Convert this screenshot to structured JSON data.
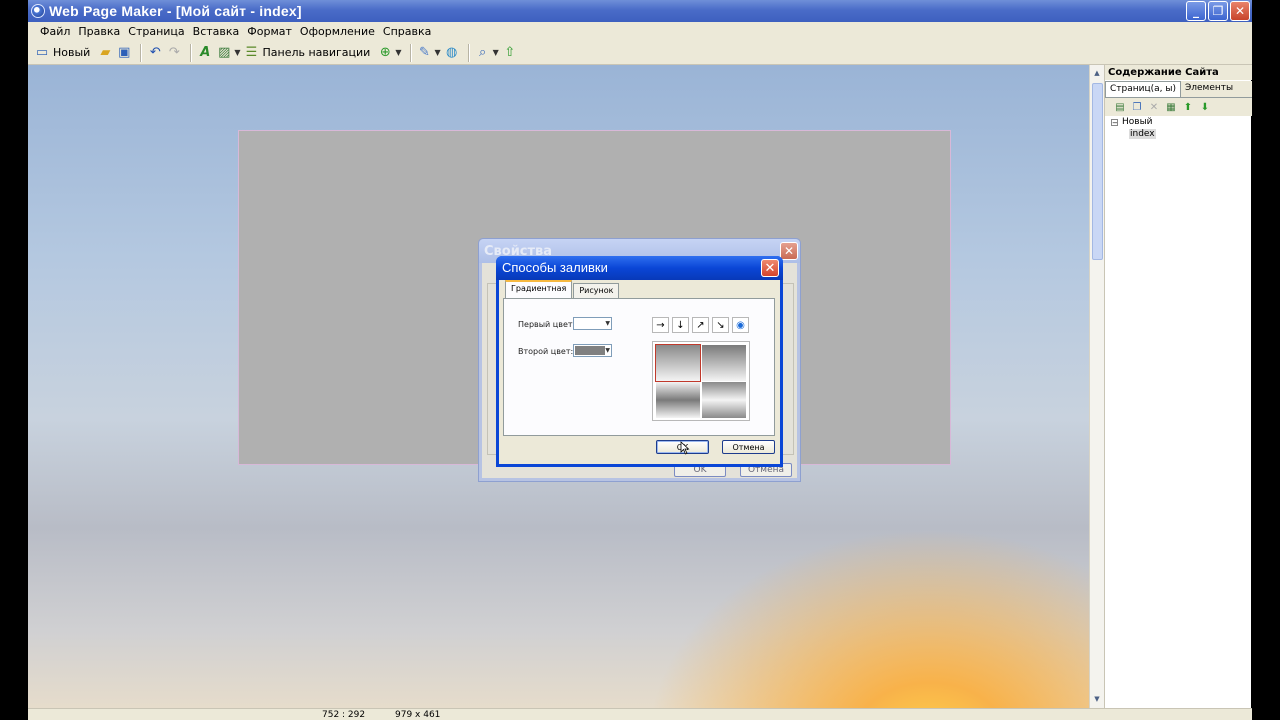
{
  "window": {
    "title": "Web Page Maker - [Мой сайт - index]"
  },
  "menu": [
    "Файл",
    "Правка",
    "Страница",
    "Вставка",
    "Формат",
    "Оформление",
    "Справка"
  ],
  "toolbar": {
    "new_label": "Новый",
    "nav_panel_label": "Панель навигации"
  },
  "right_panel": {
    "header": "Содержание Сайта",
    "tabs": [
      "Страниц(а, ы)",
      "Элементы"
    ],
    "tree": {
      "root": "Новый",
      "child": "index"
    }
  },
  "status": {
    "coords": "752 : 292",
    "size": "979 x 461"
  },
  "back_dialog": {
    "title": "Свойства",
    "ok": "OK",
    "cancel": "Отмена"
  },
  "fill_dialog": {
    "title": "Способы заливки",
    "tabs": [
      "Градиентная",
      "Рисунок"
    ],
    "first_color_label": "Первый цвет:",
    "second_color_label": "Второй цвет:",
    "first_color": "#ffffff",
    "second_color": "#808080",
    "direction_arrows": [
      "→",
      "↓",
      "↗",
      "↘",
      "◉"
    ],
    "ok": "OK",
    "cancel": "Отмена"
  }
}
